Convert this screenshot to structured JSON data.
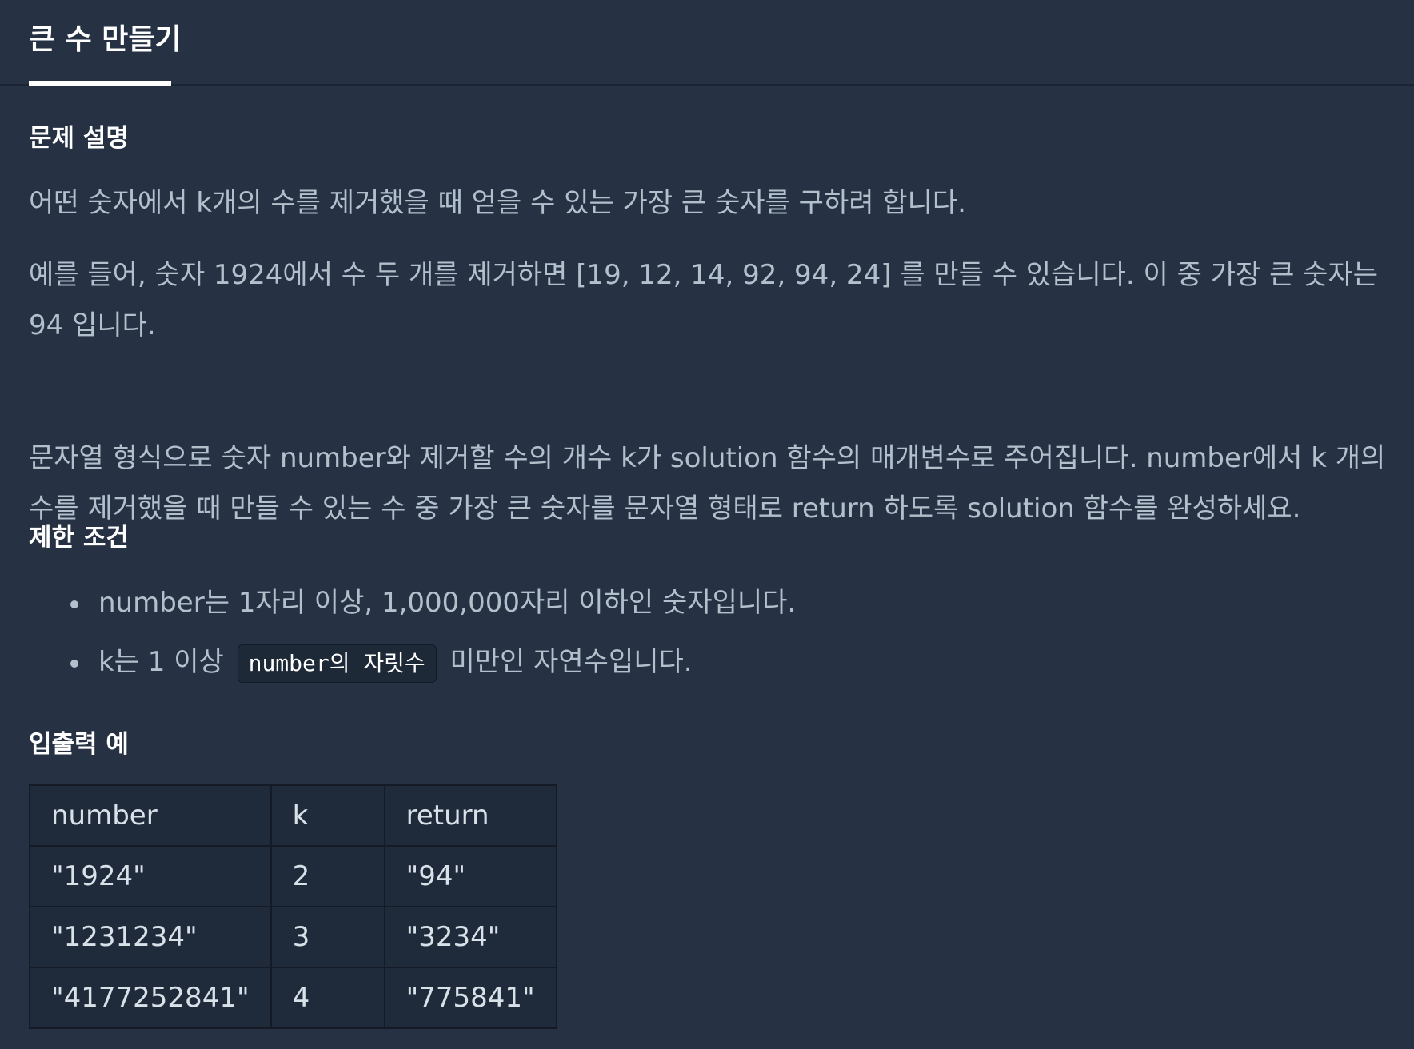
{
  "tab": {
    "title": "큰 수 만들기"
  },
  "sections": {
    "description_title": "문제 설명",
    "constraints_title": "제한 조건",
    "examples_title": "입출력 예"
  },
  "description": {
    "p1": "어떤 숫자에서 k개의 수를 제거했을 때 얻을 수 있는 가장 큰 숫자를 구하려 합니다.",
    "p2": "예를 들어, 숫자 1924에서 수 두 개를 제거하면 [19, 12, 14, 92, 94, 24] 를 만들 수 있습니다. 이 중 가장 큰 숫자는 94 입니다.",
    "p3": "문자열 형식으로 숫자 number와 제거할 수의 개수 k가 solution 함수의 매개변수로 주어집니다. number에서 k 개의 수를 제거했을 때 만들 수 있는 수 중 가장 큰 숫자를 문자열 형태로 return 하도록 solution 함수를 완성하세요."
  },
  "constraints": {
    "item1": "number는 1자리 이상, 1,000,000자리 이하인 숫자입니다.",
    "item2_prefix": "k는 1 이상",
    "item2_code": "number의 자릿수",
    "item2_suffix": "미만인 자연수입니다."
  },
  "examples": {
    "headers": [
      "number",
      "k",
      "return"
    ],
    "rows": [
      [
        "\"1924\"",
        "2",
        "\"94\""
      ],
      [
        "\"1231234\"",
        "3",
        "\"3234\""
      ],
      [
        "\"4177252841\"",
        "4",
        "\"775841\""
      ]
    ]
  },
  "colors": {
    "background": "#263244",
    "text": "#b2c0cc",
    "heading": "#ffffff",
    "table_cell": "#1f2a3b",
    "border": "#141b26"
  }
}
